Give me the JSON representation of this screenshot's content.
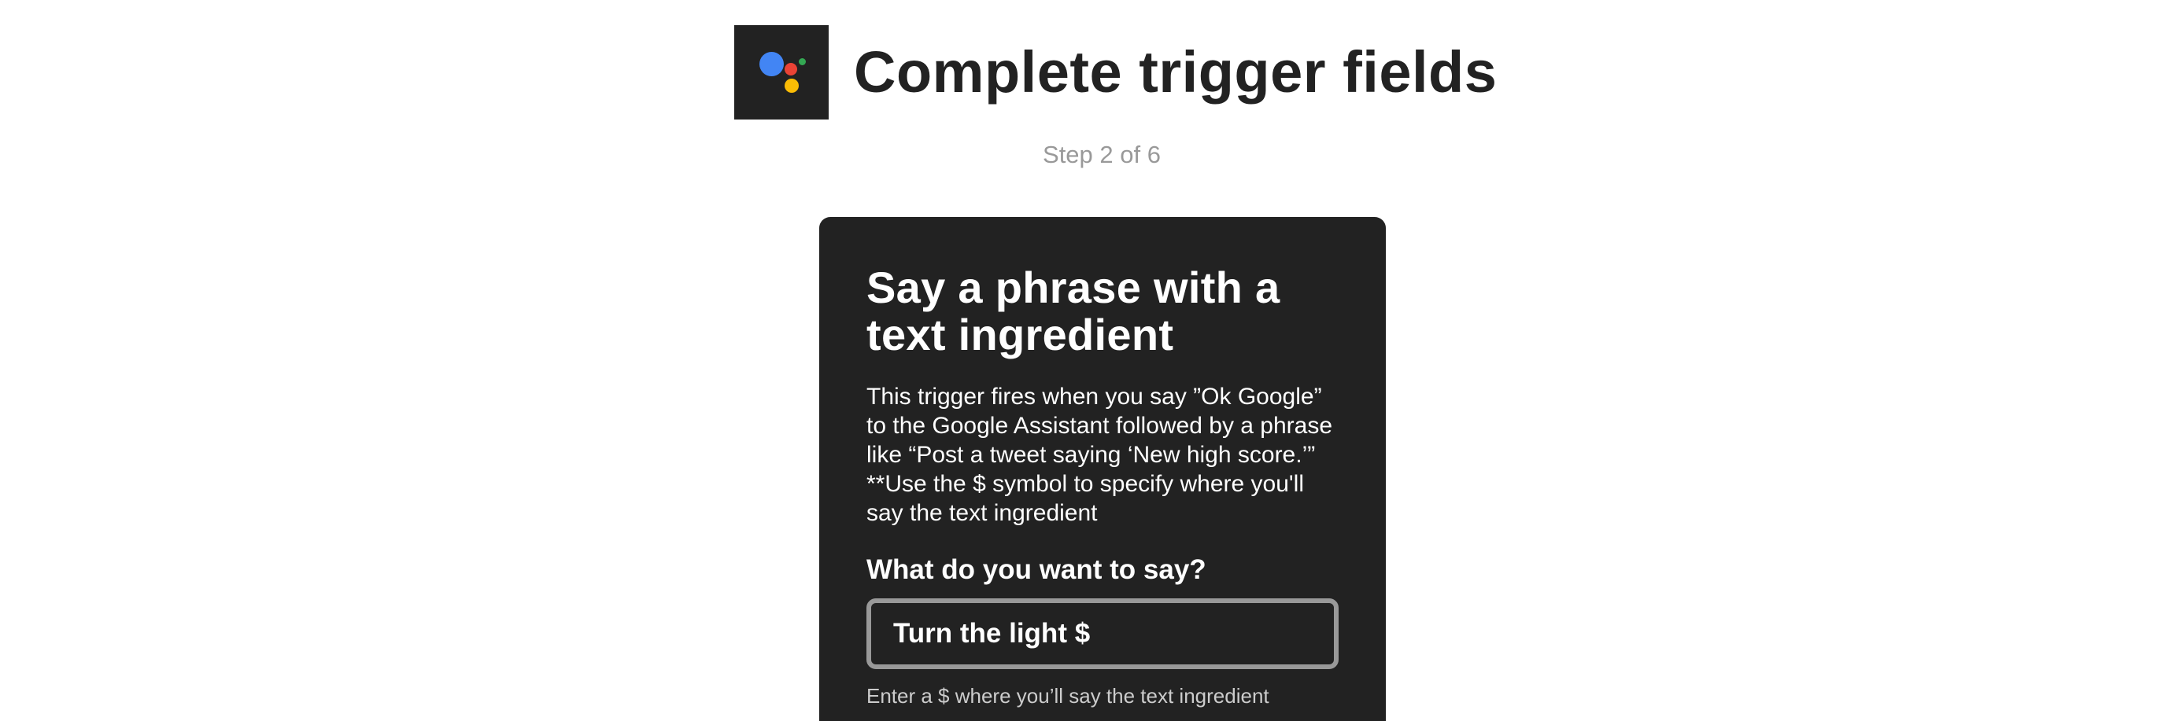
{
  "header": {
    "service_icon": "google-assistant-icon",
    "title": "Complete trigger fields"
  },
  "step": {
    "text": "Step 2 of 6"
  },
  "trigger_card": {
    "title": "Say a phrase with a text ingredient",
    "description": "This trigger fires when you say ”Ok Google” to the Google Assistant followed by a phrase like “Post a tweet saying ‘New high score.’” **Use the $ symbol to specify where you'll say the text ingredient",
    "field_label": "What do you want to say?",
    "field_value": "Turn the light $",
    "helper_text": "Enter a $ where you’ll say the text ingredient"
  },
  "colors": {
    "card_background": "#222222",
    "title_text": "#222222",
    "step_text": "#999999",
    "input_border": "#999999",
    "assistant_blue": "#4285F4",
    "assistant_red": "#EA4335",
    "assistant_yellow": "#FBBC05",
    "assistant_green": "#34A853"
  }
}
